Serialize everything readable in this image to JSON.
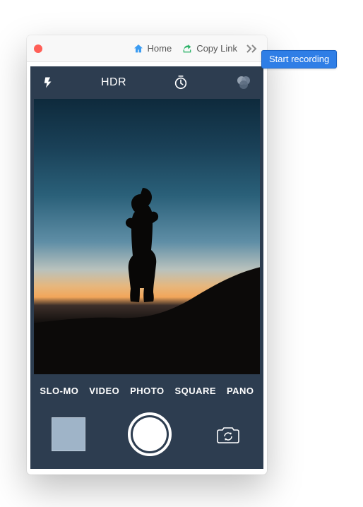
{
  "titlebar": {
    "home_label": "Home",
    "copy_link_label": "Copy Link"
  },
  "tooltip": {
    "start_recording": "Start recording"
  },
  "camera": {
    "top": {
      "hdr_label": "HDR"
    },
    "modes": [
      "SLO-MO",
      "VIDEO",
      "PHOTO",
      "SQUARE",
      "PANO"
    ]
  },
  "colors": {
    "accent": "#2f7ee6",
    "phone_bg": "#2d3d50"
  }
}
